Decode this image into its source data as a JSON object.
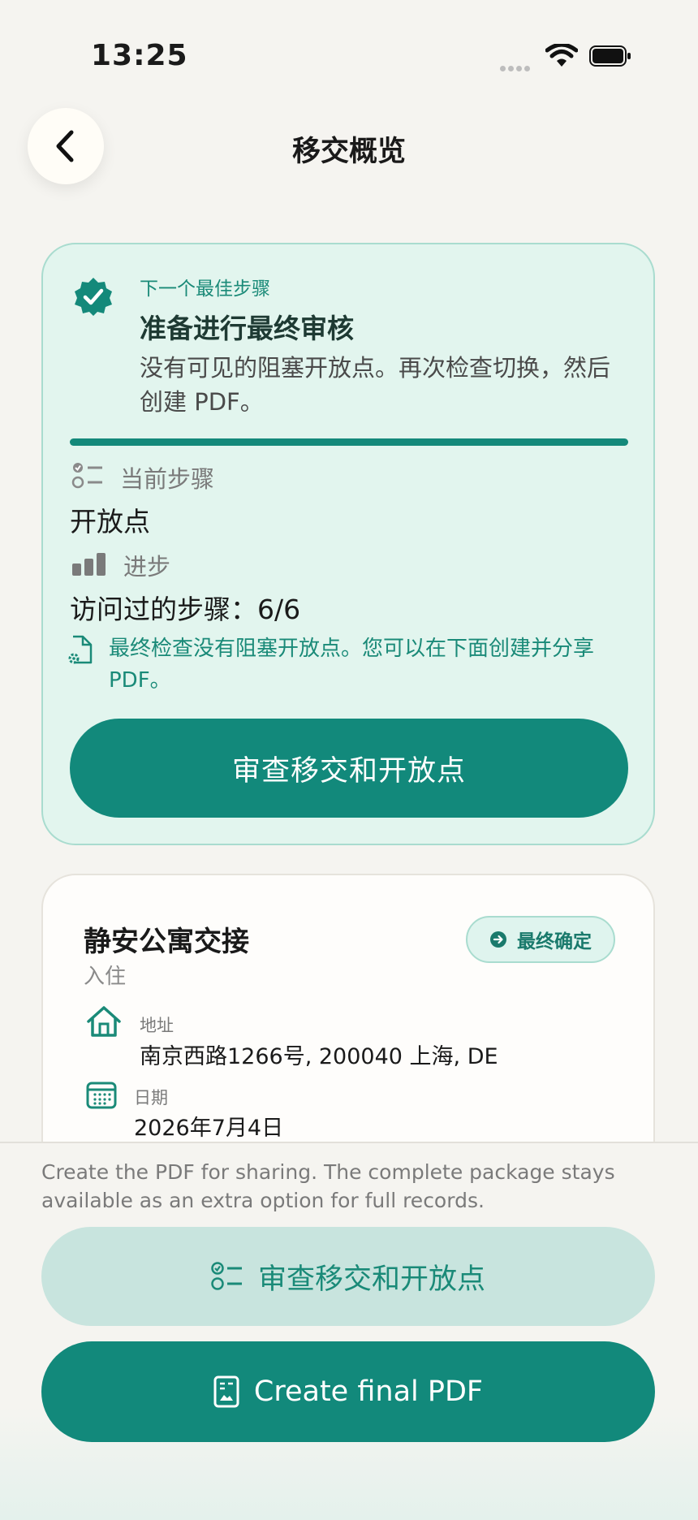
{
  "status_bar": {
    "time": "13:25"
  },
  "nav": {
    "title": "移交概览"
  },
  "next_step": {
    "eyebrow": "下一个最佳步骤",
    "title": "准备进行最终审核",
    "description": "没有可见的阻塞开放点。再次检查切换，然后创建 PDF。",
    "progress_fraction": 1.0,
    "current_step_label": "当前步骤",
    "current_step_value": "开放点",
    "progress_label": "进步",
    "progress_value": "访问过的步骤：6/6",
    "note": "最终检查没有阻塞开放点。您可以在下面创建并分享 PDF。",
    "action_label": "审查移交和开放点"
  },
  "summary": {
    "title": "静安公寓交接",
    "subtitle": "入住",
    "status_badge": "最终确定",
    "address_label": "地址",
    "address_value": "南京西路1266号, 200040 上海, DE",
    "date_label": "日期",
    "date_value": "2026年7月4日"
  },
  "footer": {
    "hint": "Create the PDF for sharing. The complete package stays available as an extra option for full records.",
    "review_button": "审查移交和开放点",
    "pdf_button": "Create final PDF"
  },
  "colors": {
    "accent": "#12897b",
    "card_mint": "#e2f5ee",
    "background": "#f5f4f0"
  }
}
